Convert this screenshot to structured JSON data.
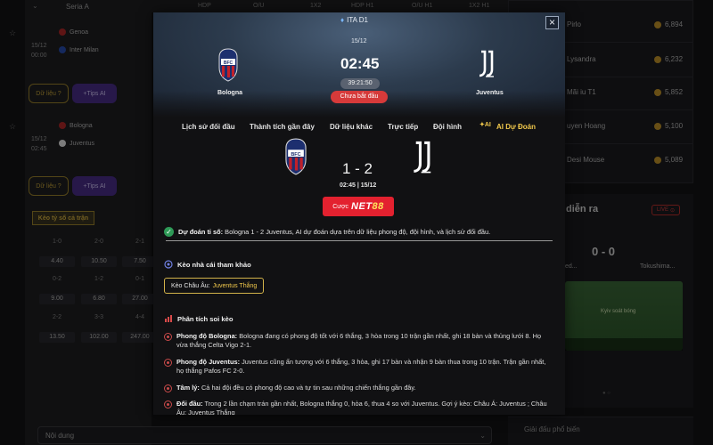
{
  "background": {
    "league_label": "Seria A",
    "column_headers": [
      "HDP",
      "O/U",
      "1X2",
      "HDP H1",
      "O/U H1",
      "1X2 H1"
    ],
    "matches": [
      {
        "date": "15/12",
        "time": "00:00",
        "home": "Genoa",
        "away": "Inter Milan"
      },
      {
        "date": "15/12",
        "time": "02:45",
        "home": "Bologna",
        "away": "Juventus"
      }
    ],
    "data_button": "Dữ liệu ?",
    "tips_button": "+Tips AI",
    "odds_tab": "Kèo tỷ số cả trận",
    "odds": [
      {
        "score": "1-0",
        "odd": "4.40"
      },
      {
        "score": "2-0",
        "odd": "10.50"
      },
      {
        "score": "2-1",
        "odd": "7.50"
      },
      {
        "score": "0-2",
        "odd": "9.00"
      },
      {
        "score": "1-2",
        "odd": "6.80"
      },
      {
        "score": "0-1",
        "odd": "27.00"
      },
      {
        "score": "2-2",
        "odd": "13.50"
      },
      {
        "score": "3-3",
        "odd": "102.00"
      },
      {
        "score": "4-4",
        "odd": "247.00"
      }
    ],
    "content_select": "Nội dung",
    "leaderboard": [
      {
        "name": "Pirlo",
        "points": "6,894"
      },
      {
        "name": "Lysandra",
        "points": "6,232"
      },
      {
        "name": "Mãi iu T1",
        "points": "5,852"
      },
      {
        "name": "uyen Hoang",
        "points": "5,100"
      },
      {
        "name": "Desi Mouse",
        "points": "5,089"
      }
    ],
    "live_title": "diễn ra",
    "live_badge": "LIVE",
    "live_score": "0 - 0",
    "live_home": "ed...",
    "live_away": "Tokushima...",
    "pitch_label": "Kyiv soát bóng",
    "bottom_right_label": "Giải đấu phổ biến"
  },
  "modal": {
    "league": "ITA D1",
    "date": "15/12",
    "kickoff": "02:45",
    "countdown": "39:21:50",
    "status": "Chưa bắt đầu",
    "home_team": "Bologna",
    "away_team": "Juventus",
    "tabs": [
      "Lịch sử đối đầu",
      "Thành tích gần đây",
      "Dữ liệu khác",
      "Trực tiếp",
      "Đội hình",
      "AI Dự Đoán"
    ],
    "ai_mark": "AI",
    "predicted_score": "1 - 2",
    "match_meta": "02:45 | 15/12",
    "bet_prefix": "Cược",
    "bet_brand": "NET",
    "bet_brand_suffix": "88",
    "prediction_label": "Dự đoán tỉ số:",
    "prediction_text": "Bologna 1 - 2 Juventus, AI dự đoán dựa trên dữ liệu phong độ, đội hình, và lịch sử đối đầu.",
    "ref_title": "Kèo nhà cái tham khảo",
    "ref_label": "Kèo Châu Âu:",
    "ref_value": "Juventus Thắng",
    "analysis_title": "Phân tích soi kèo",
    "analysis": [
      {
        "label": "Phong độ Bologna:",
        "text": "Bologna đang có phong độ tốt với 6 thắng, 3 hòa trong 10 trận gần nhất, ghi 18 bàn và thủng lưới 8. Họ vừa thắng Celta Vigo 2-1."
      },
      {
        "label": "Phong độ Juventus:",
        "text": "Juventus cũng ấn tượng với 6 thắng, 3 hòa, ghi 17 bàn và nhận 9 bàn thua trong 10 trận. Trận gần nhất, họ thắng Pafos FC 2-0."
      },
      {
        "label": "Tâm lý:",
        "text": "Cả hai đội đều có phong độ cao và tự tin sau những chiến thắng gần đây."
      },
      {
        "label": "Đối đầu:",
        "text": "Trong 2 lần chạm trán gần nhất, Bologna thắng 0, hòa 6, thua 4 so với Juventus. Gợi ý kèo: Châu Á: Juventus ; Châu Âu: Juventus Thắng"
      }
    ],
    "colors": {
      "accent_red": "#e3212f",
      "ai_gold": "#f2c94c",
      "status_red": "#d63a3a"
    }
  }
}
